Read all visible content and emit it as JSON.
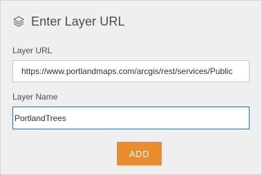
{
  "header": {
    "icon": "layers-icon",
    "title": "Enter Layer URL"
  },
  "form": {
    "url_label": "Layer URL",
    "url_value": "https://www.portlandmaps.com/arcgis/rest/services/Public",
    "name_label": "Layer Name",
    "name_value": "PortlandTrees",
    "add_label": "ADD"
  },
  "colors": {
    "accent": "#e98d2f",
    "focus_border": "#3a6c93",
    "panel_background": "#efefef"
  }
}
